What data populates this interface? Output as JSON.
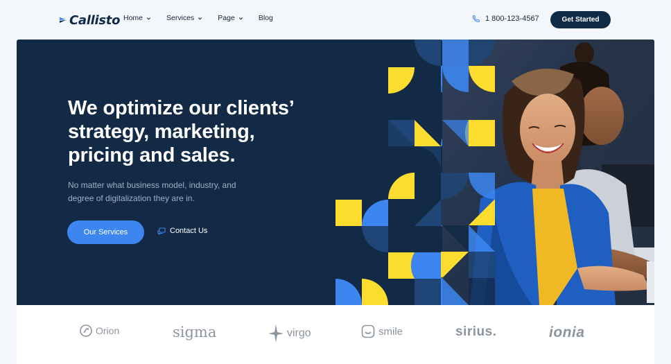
{
  "brand": {
    "name": "Callisto"
  },
  "nav": {
    "items": [
      {
        "label": "Home",
        "has_dropdown": true
      },
      {
        "label": "Services",
        "has_dropdown": true
      },
      {
        "label": "Page",
        "has_dropdown": true
      },
      {
        "label": "Blog",
        "has_dropdown": false
      }
    ]
  },
  "header": {
    "phone": "1 800-123-4567",
    "cta_label": "Get Started",
    "phone_icon": "phone-icon"
  },
  "hero": {
    "title_line1": "We optimize our clients’",
    "title_line2": "strategy, marketing,",
    "title_line3": "pricing and sales.",
    "subtitle_line1": "No matter what business model, industry, and",
    "subtitle_line2": "degree of digitalization they are in.",
    "primary_button": "Our Services",
    "secondary_button": "Contact Us",
    "secondary_icon": "chat-icon"
  },
  "partners": [
    {
      "name": "Orion",
      "label": "Orion",
      "icon": "orion-icon"
    },
    {
      "name": "sigma",
      "label": "sigma"
    },
    {
      "name": "virgo",
      "label": "virgo",
      "icon": "star-icon"
    },
    {
      "name": "smile",
      "label": "smile",
      "icon": "smile-icon"
    },
    {
      "name": "sirius",
      "label": "sirius."
    },
    {
      "name": "ionia",
      "label": "ionia"
    }
  ],
  "colors": {
    "navy": "#132a47",
    "accent_blue": "#3d86f0",
    "accent_yellow": "#fcdc2f",
    "cta_dark": "#0f2a47",
    "page_bg": "#f3f6fa"
  }
}
